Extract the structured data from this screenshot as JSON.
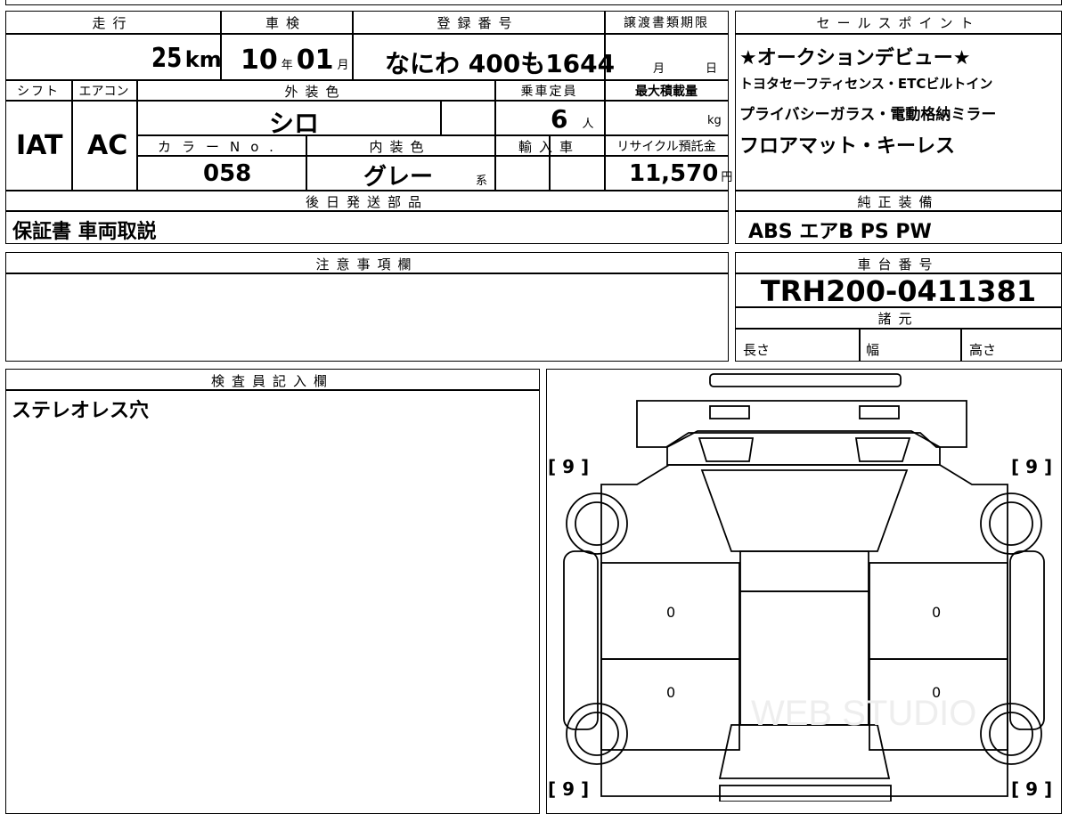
{
  "top_table": {
    "headers": {
      "mileage": "走行",
      "inspection": "車検",
      "registration": "登録番号",
      "transfer_deadline": "譲渡書類期限",
      "shift": "シフト",
      "aircon": "エアコン",
      "exterior_color": "外装色",
      "capacity": "乗車定員",
      "max_load": "最大積載量",
      "color_no": "カラーNo.",
      "interior_color": "内装色",
      "imported": "輸入車",
      "recycle_fee": "リサイクル預託金"
    },
    "mileage_value": "25",
    "mileage_unit": "km",
    "inspection_year": "10",
    "inspection_year_unit": "年",
    "inspection_month": "01",
    "inspection_month_unit": "月",
    "registration_value": "なにわ 400も1644",
    "transfer_month_unit": "月",
    "transfer_day_unit": "日",
    "shift_value": "IAT",
    "aircon_value": "AC",
    "exterior_color_value": "シロ",
    "capacity_value": "6",
    "capacity_unit": "人",
    "max_load_unit": "kg",
    "color_no_value": "058",
    "interior_color_value": "グレー",
    "interior_color_suffix": "系",
    "recycle_fee_value": "11,570",
    "recycle_fee_unit": "円"
  },
  "later_parts": {
    "header": "後日発送部品",
    "value": "保証書 車両取説"
  },
  "sales_points": {
    "header": "セールスポイント",
    "lines": [
      "★オークションデビュー★",
      "トヨタセーフティセンス・ETCビルトイン",
      "プライバシーガラス・電動格納ミラー",
      "フロアマット・キーレス"
    ]
  },
  "genuine_equipment": {
    "header": "純正装備",
    "value": "ABS エアB PS PW"
  },
  "notes": {
    "header": "注意事項欄"
  },
  "chassis": {
    "header": "車台番号",
    "value": "TRH200-0411381"
  },
  "specs": {
    "header": "諸元",
    "length": "長さ",
    "width": "幅",
    "height": "高さ"
  },
  "inspector": {
    "header": "検査員記入欄",
    "value": "ステレオレス穴"
  },
  "diagram": {
    "tire_depth_fl": "[ 9 ]",
    "tire_depth_fr": "[ 9 ]",
    "tire_depth_rl": "[ 9 ]",
    "tire_depth_rr": "[ 9 ]",
    "door_left_front": "0",
    "door_left_rear": "0",
    "door_right_front": "0",
    "door_right_rear": "0",
    "watermark": "WEB STUDIO"
  }
}
